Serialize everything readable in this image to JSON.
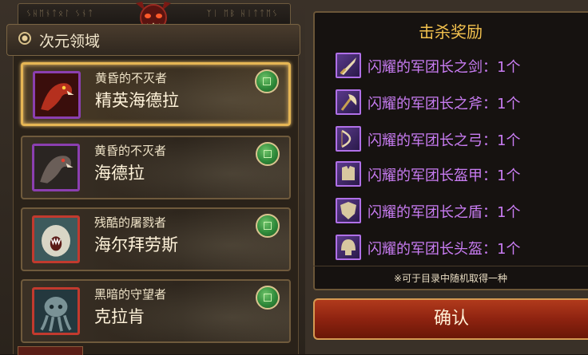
{
  "banner": {
    "runes_left": "ᛊᚺᛖᚾᛏᛟᛚ ᛊᚾᛏ",
    "runes_right": "ᛉᛁ ᛖᛒ ᚺᛁᛏᛏᛖᛊ"
  },
  "region": {
    "title": "次元领域"
  },
  "bosses": [
    {
      "subtitle": "黄昏的不灭者",
      "name": "精英海德拉",
      "frame_color": "#8b3fb0",
      "selected": true
    },
    {
      "subtitle": "黄昏的不灭者",
      "name": "海德拉",
      "frame_color": "#8b3fb0",
      "selected": false
    },
    {
      "subtitle": "残酷的屠戮者",
      "name": "海尔拜劳斯",
      "frame_color": "#c23a2e",
      "selected": false
    },
    {
      "subtitle": "黑暗的守望者",
      "name": "克拉肯",
      "frame_color": "#c23a2e",
      "selected": false
    }
  ],
  "rewards": {
    "title": "击杀奖励",
    "items": [
      {
        "label": "闪耀的军团长之剑：1个",
        "icon": "sword-icon"
      },
      {
        "label": "闪耀的军团长之斧：1个",
        "icon": "axe-icon"
      },
      {
        "label": "闪耀的军团长之弓：1个",
        "icon": "bow-icon"
      },
      {
        "label": "闪耀的军团长盔甲：1个",
        "icon": "armor-icon"
      },
      {
        "label": "闪耀的军团长之盾：1个",
        "icon": "shield-icon"
      },
      {
        "label": "闪耀的军团长头盔：1个",
        "icon": "helmet-icon"
      }
    ],
    "note": "※可于目录中随机取得一种",
    "confirm_label": "确认"
  },
  "colors": {
    "reward_text": "#c87cf2",
    "reward_title": "#f2c14e",
    "selected_border": "#e6b654",
    "confirm_bg": "#8e2310"
  }
}
